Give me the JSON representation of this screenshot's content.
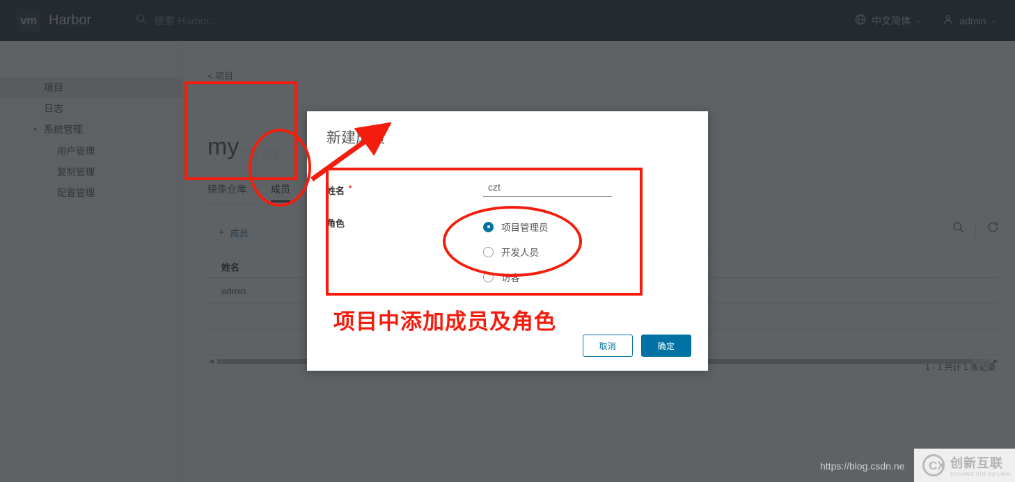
{
  "header": {
    "logo_text": "vm",
    "brand": "Harbor",
    "search_placeholder": "搜索 Harbor...",
    "language": "中文简体",
    "user": "admin",
    "caret": "⌄"
  },
  "sidebar": {
    "items": [
      {
        "label": "项目",
        "active": true
      },
      {
        "label": "日志",
        "active": false
      },
      {
        "label": "系统管理",
        "active": false,
        "expandable": true
      },
      {
        "label": "用户管理",
        "sub": true
      },
      {
        "label": "复制管理",
        "sub": true
      },
      {
        "label": "配置管理",
        "sub": true
      }
    ]
  },
  "content": {
    "breadcrumb": "< 项目",
    "project_title": "my",
    "project_tag": "项目管理",
    "tabs": [
      {
        "label": "镜像仓库",
        "active": false
      },
      {
        "label": "成员",
        "active": true
      }
    ],
    "add_member_label": "成员",
    "add_member_plus": "+",
    "table": {
      "columns": [
        "姓名"
      ],
      "rows": [
        [
          "admin"
        ]
      ],
      "pagination": "1 - 1 共计 1 条记录"
    }
  },
  "modal": {
    "title": "新建成员",
    "name_label": "姓名",
    "required_mark": "*",
    "name_value": "czt",
    "name_placeholder": "",
    "role_label": "角色",
    "roles": [
      {
        "label": "项目管理员",
        "selected": true
      },
      {
        "label": "开发人员",
        "selected": false
      },
      {
        "label": "访客",
        "selected": false
      }
    ],
    "cancel_label": "取消",
    "confirm_label": "确定"
  },
  "annotation": {
    "caption": "项目中添加成员及角色",
    "color": "#f41d0d"
  },
  "footer": {
    "watermark": "https://blog.csdn.ne",
    "badge_cn": "创新互联",
    "badge_en": "CHUANG XIN HU LIAN",
    "badge_mark": "CX"
  },
  "colors": {
    "topbar": "#2b3840",
    "accent_blue": "#0072a3",
    "tab_underline": "#3b5363",
    "annotation_red": "#f41d0d"
  }
}
